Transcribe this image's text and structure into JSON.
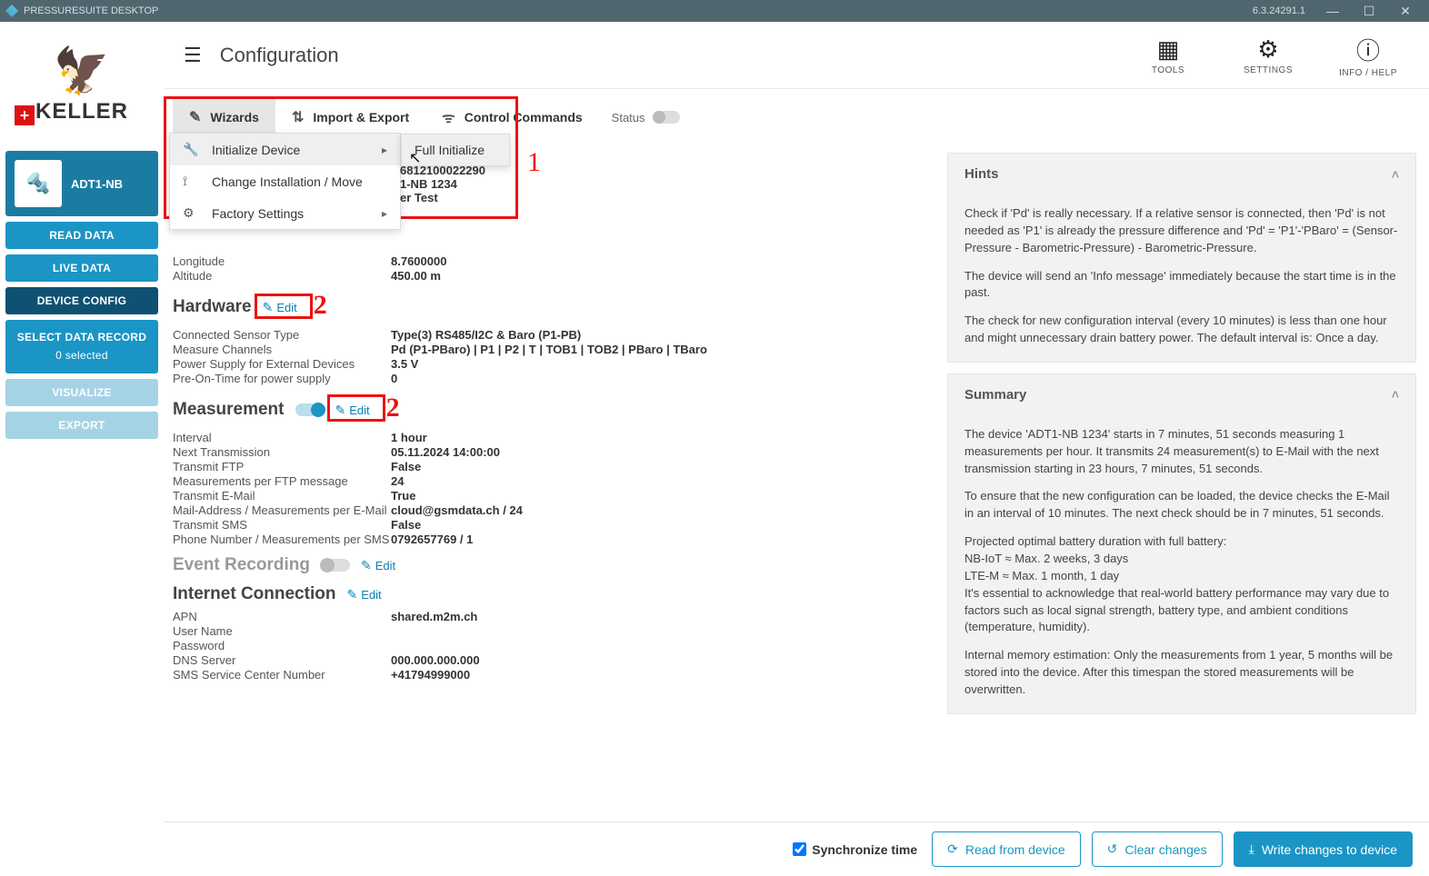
{
  "titlebar": {
    "title": "PRESSURESUITE DESKTOP",
    "version": "6.3.24291.1"
  },
  "brand": {
    "name": "KELLER"
  },
  "device": {
    "name": "ADT1-NB"
  },
  "sidebar": {
    "read_data": "READ DATA",
    "live_data": "LIVE DATA",
    "device_config": "DEVICE CONFIG",
    "select_record": "SELECT DATA RECORD",
    "selected_count": "0 selected",
    "visualize": "VISUALIZE",
    "export": "EXPORT"
  },
  "header": {
    "title": "Configuration",
    "tools_label": "TOOLS",
    "settings_label": "SETTINGS",
    "help_label": "INFO / HELP"
  },
  "tabs": {
    "wizards": "Wizards",
    "import_export": "Import & Export",
    "control_commands": "Control Commands",
    "status_label": "Status"
  },
  "dropdown": {
    "initialize_device": "Initialize Device",
    "change_installation": "Change Installation / Move",
    "factory_settings": "Factory Settings",
    "full_initialize": "Full Initialize"
  },
  "annotations": {
    "one": "1",
    "two_a": "2",
    "two_b": "2"
  },
  "device_info_visible": {
    "serial_fragment": "6812100022290",
    "name_fragment": "1-NB 1234",
    "note_fragment": "er Test",
    "longitude_label": "Longitude",
    "longitude": "8.7600000",
    "altitude_label": "Altitude",
    "altitude": "450.00 m"
  },
  "sections": {
    "hardware": {
      "title": "Hardware",
      "edit": "Edit",
      "rows": {
        "connected_sensor_type": {
          "k": "Connected Sensor Type",
          "v": "Type(3) RS485/I2C & Baro (P1-PB)"
        },
        "measure_channels": {
          "k": "Measure Channels",
          "v": "Pd (P1-PBaro) | P1 | P2 | T | TOB1 | TOB2 | PBaro | TBaro"
        },
        "power_supply": {
          "k": "Power Supply for External Devices",
          "v": "3.5 V"
        },
        "pre_on_time": {
          "k": "Pre-On-Time for power supply",
          "v": "0"
        }
      }
    },
    "measurement": {
      "title": "Measurement",
      "edit": "Edit",
      "rows": {
        "interval": {
          "k": "Interval",
          "v": "1 hour"
        },
        "next_transmission": {
          "k": "Next Transmission",
          "v": "05.11.2024 14:00:00"
        },
        "transmit_ftp": {
          "k": "Transmit FTP",
          "v": "False"
        },
        "measurements_per_ftp": {
          "k": "Measurements per FTP message",
          "v": "24"
        },
        "transmit_email": {
          "k": "Transmit E-Mail",
          "v": "True"
        },
        "mail_address": {
          "k": "Mail-Address / Measurements per E-Mail",
          "v": "cloud@gsmdata.ch / 24"
        },
        "transmit_sms": {
          "k": "Transmit SMS",
          "v": "False"
        },
        "phone_sms": {
          "k": "Phone Number / Measurements per SMS",
          "v": "0792657769 / 1"
        }
      }
    },
    "event_recording": {
      "title": "Event Recording",
      "edit": "Edit"
    },
    "internet": {
      "title": "Internet Connection",
      "edit": "Edit",
      "rows": {
        "apn": {
          "k": "APN",
          "v": "shared.m2m.ch"
        },
        "user_name": {
          "k": "User Name",
          "v": ""
        },
        "password": {
          "k": "Password",
          "v": ""
        },
        "dns_server": {
          "k": "DNS Server",
          "v": "000.000.000.000"
        },
        "sms_center": {
          "k": "SMS Service Center Number",
          "v": "+41794999000"
        }
      }
    }
  },
  "hints": {
    "title": "Hints",
    "p1": "Check if 'Pd' is really necessary. If a relative sensor is connected, then 'Pd' is not needed as 'P1' is already the pressure difference and 'Pd' = 'P1'-'PBaro' = (Sensor-Pressure - Barometric-Pressure) - Barometric-Pressure.",
    "p2": "The device will send an 'Info message' immediately because the start time is in the past.",
    "p3": "The check for new configuration interval (every 10 minutes) is less than one hour and might unnecessary drain battery power. The default interval is: Once a day."
  },
  "summary": {
    "title": "Summary",
    "p1": "The device 'ADT1-NB 1234' starts in 7 minutes, 51 seconds measuring 1 measurements per hour. It transmits 24 measurement(s) to E-Mail with the next transmission starting in 23 hours, 7 minutes, 51 seconds.",
    "p2": "To ensure that the new configuration can be loaded, the device checks the E-Mail in an interval of 10 minutes. The next check should be in 7 minutes, 51 seconds.",
    "p3": "Projected optimal battery duration with full battery:\n  NB-IoT ≈ Max. 2 weeks, 3 days\n  LTE-M ≈ Max. 1 month, 1 day\nIt's essential to acknowledge that real-world battery performance may vary due to factors such as local signal strength, battery type, and ambient conditions (temperature, humidity).",
    "p4": "Internal memory estimation: Only the measurements from 1 year, 5 months will be stored into the device. After this timespan the stored measurements will be overwritten."
  },
  "bottombar": {
    "sync_time": "Synchronize time",
    "read": "Read from device",
    "clear": "Clear changes",
    "write": "Write changes to device"
  }
}
